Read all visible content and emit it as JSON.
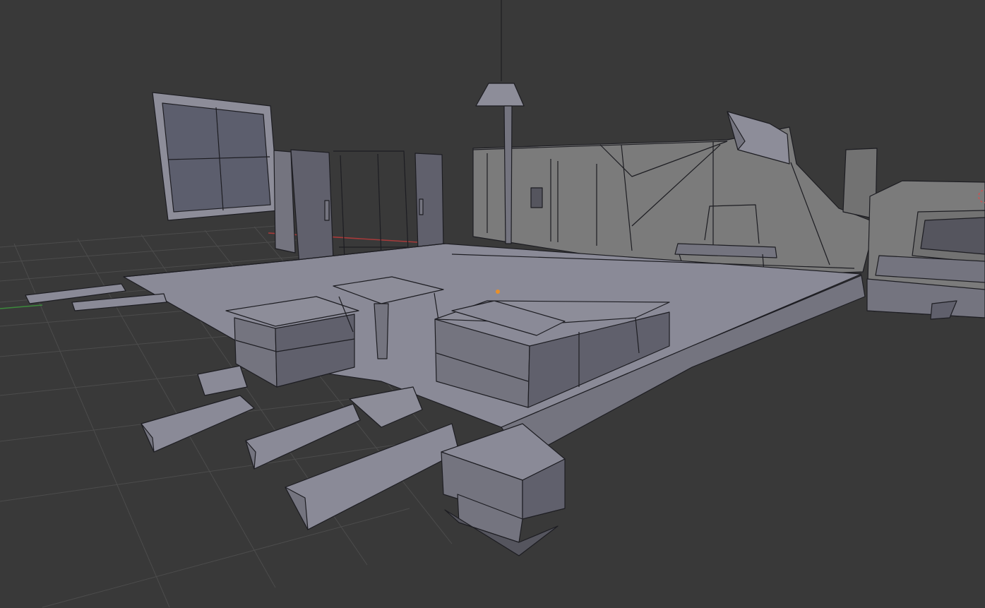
{
  "viewport": {
    "background": "#393939",
    "grid_color": "#4c4c4c",
    "mesh_color": "#7a7a86",
    "wire_color": "#1d1d22",
    "x_axis_color": "#a83a3a",
    "y_axis_color": "#3c8a3c",
    "origin_color": "#e8902a"
  },
  "scene": {
    "objects": [
      "floor-platform",
      "window-frame",
      "glass-door",
      "ceiling-lamp",
      "back-wall",
      "counter-box",
      "crate",
      "chair",
      "monitor",
      "wall-switch",
      "support-beams",
      "chimney-pipe"
    ]
  }
}
